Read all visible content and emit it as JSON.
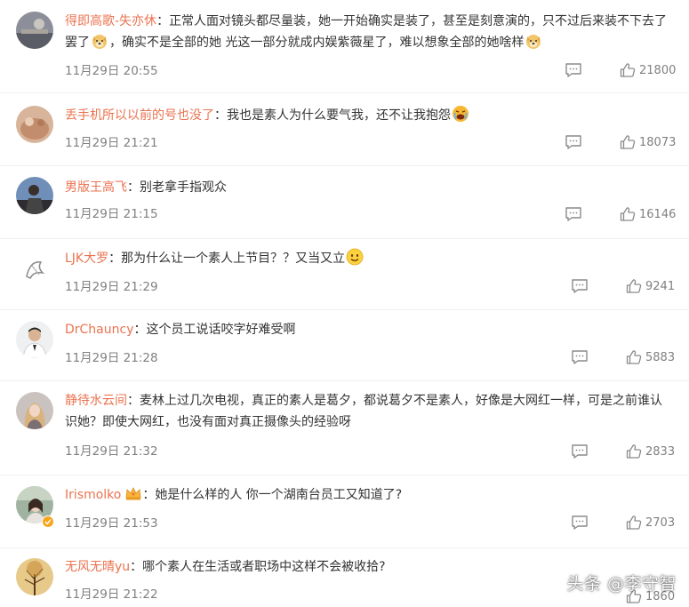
{
  "comments": [
    {
      "user": "得即高歌-失亦休",
      "text_1": "正常人面对镜头都尽量装，她一开始确实是装了，甚至是刻意演的，只不过后来装不下去了罢了",
      "text_2": "，确实不是全部的她 光这一部分就成内娱紫薇星了，难以想象全部的她啥样",
      "time": "11月29日 20:55",
      "likes": "21800"
    },
    {
      "user": "丢手机所以以前的号也没了",
      "text_1": "我也是素人为什么要气我，还不让我抱怨",
      "time": "11月29日 21:21",
      "likes": "18073"
    },
    {
      "user": "男版王高飞",
      "text_1": "别老拿手指观众",
      "time": "11月29日 21:15",
      "likes": "16146"
    },
    {
      "user": "LJK大罗",
      "text_1": "那为什么让一个素人上节目？？又当又立",
      "time": "11月29日 21:29",
      "likes": "9241"
    },
    {
      "user": "DrChauncy",
      "text_1": "这个员工说话咬字好难受啊",
      "time": "11月29日 21:28",
      "likes": "5883"
    },
    {
      "user": "静待水云间",
      "text_1": "麦林上过几次电视，真正的素人是葛夕，都说葛夕不是素人，好像是大网红一样，可是之前谁认识她？即使大网红，也没有面对真正摄像头的经验呀",
      "time": "11月29日 21:32",
      "likes": "2833"
    },
    {
      "user": "Irismolko",
      "text_1": "她是什么样的人 你一个湖南台员工又知道了?",
      "time": "11月29日 21:53",
      "likes": "2703"
    },
    {
      "user": "无风无晴yu",
      "text_1": "哪个素人在生活或者职场中这样不会被收拾?",
      "time": "11月29日 21:22",
      "likes": "1860"
    }
  ],
  "colon": "：",
  "watermark": "头条 @李守智",
  "colors": {
    "username": "#eb7350",
    "text": "#333333",
    "meta": "#808080"
  }
}
